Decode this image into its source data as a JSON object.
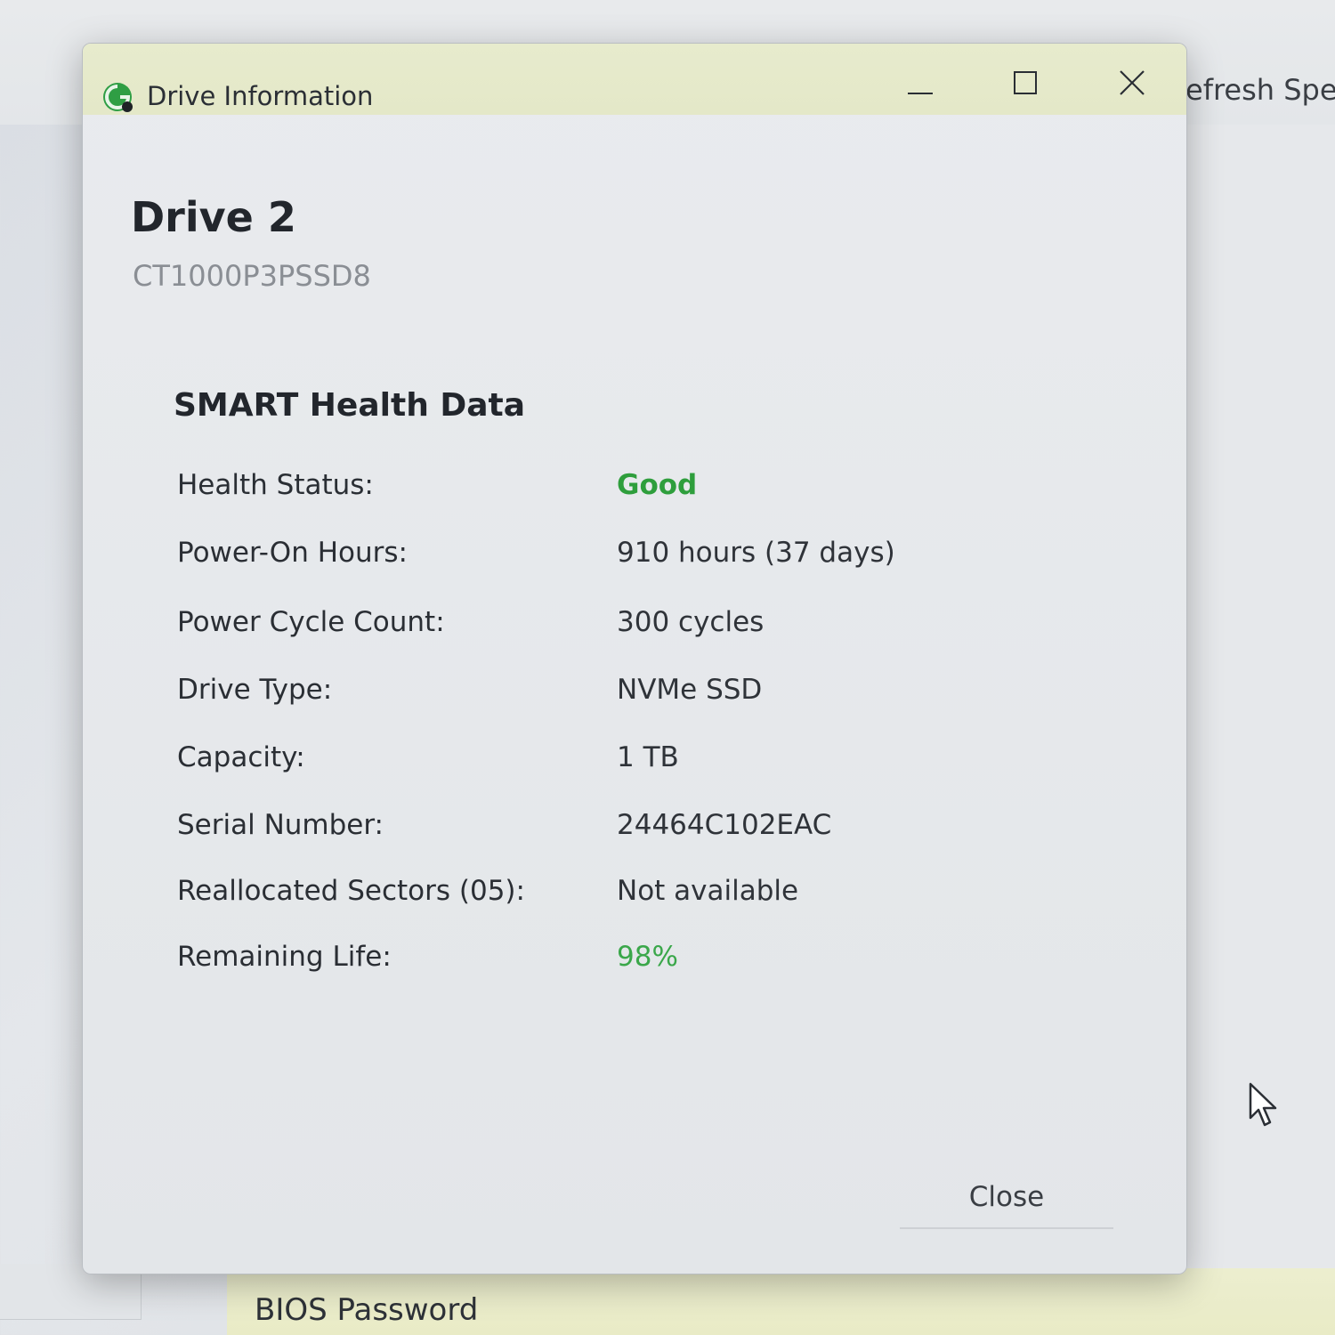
{
  "background": {
    "toolbar_fragment": "efresh Spe",
    "bios_label": "BIOS Password"
  },
  "dialog": {
    "title": "Drive Information",
    "icon": "drive-health-icon",
    "drive_name": "Drive 2",
    "drive_model": "CT1000P3PSSD8",
    "section_title": "SMART Health Data",
    "rows": [
      {
        "label": "Health Status:",
        "value": "Good",
        "status": "good"
      },
      {
        "label": "Power-On Hours:",
        "value": "910 hours (37 days)",
        "status": "normal"
      },
      {
        "label": "Power Cycle Count:",
        "value": "300 cycles",
        "status": "normal"
      },
      {
        "label": "Drive Type:",
        "value": "NVMe SSD",
        "status": "normal"
      },
      {
        "label": "Capacity:",
        "value": "1 TB",
        "status": "normal"
      },
      {
        "label": "Serial Number:",
        "value": "24464C102EAC",
        "status": "normal"
      },
      {
        "label": "Reallocated Sectors (05):",
        "value": "Not available",
        "status": "normal"
      },
      {
        "label": "Remaining Life:",
        "value": "98%",
        "status": "green"
      }
    ],
    "close_label": "Close"
  },
  "colors": {
    "good": "#2e9e3c",
    "titlebar": "#e6eacb",
    "text": "#2a2e34"
  }
}
